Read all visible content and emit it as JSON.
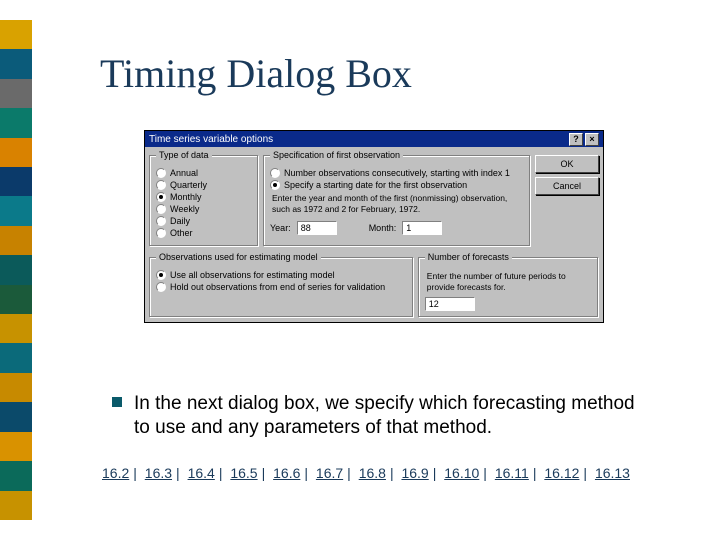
{
  "slide": {
    "title": "Timing Dialog Box",
    "bullet_text": "In the next dialog box, we specify which forecasting method to use and any parameters of that method."
  },
  "stripe_colors": [
    "#d9a200",
    "#0b5b7a",
    "#6a6a6a",
    "#0b7a6a",
    "#d98200",
    "#0b3a6a",
    "#0b7a8a",
    "#c78200",
    "#0b5a5a",
    "#1b5a3a",
    "#c79200",
    "#0b6a7a",
    "#c78a00",
    "#0b4a6a",
    "#d99200",
    "#0b6a5a",
    "#c79200"
  ],
  "dialog": {
    "title": "Time series variable options",
    "help": "?",
    "close": "×",
    "buttons": {
      "ok": "OK",
      "cancel": "Cancel"
    },
    "type_of_data": {
      "legend": "Type of data",
      "options": [
        "Annual",
        "Quarterly",
        "Monthly",
        "Weekly",
        "Daily",
        "Other"
      ],
      "selected": "Monthly"
    },
    "specification": {
      "legend": "Specification of first observation",
      "options": [
        "Number observations consecutively, starting with index 1",
        "Specify a starting date for the first observation"
      ],
      "selected": 1,
      "note": "Enter the year and month of the first (nonmissing) observation, such as 1972 and 2 for February, 1972.",
      "year_label": "Year:",
      "year_value": "88",
      "month_label": "Month:",
      "month_value": "1"
    },
    "estimating": {
      "legend": "Observations used for estimating model",
      "options": [
        "Use all observations for estimating model",
        "Hold out observations from end of series for validation"
      ],
      "selected": 0
    },
    "forecasts": {
      "legend": "Number of forecasts",
      "note": "Enter the number of future periods to provide forecasts for.",
      "value": "12"
    }
  },
  "footer": {
    "links": [
      "16.2",
      "16.3",
      "16.4",
      "16.5",
      "16.6",
      "16.7",
      "16.8",
      "16.9",
      "16.10",
      "16.11",
      "16.12",
      "16.13"
    ]
  }
}
